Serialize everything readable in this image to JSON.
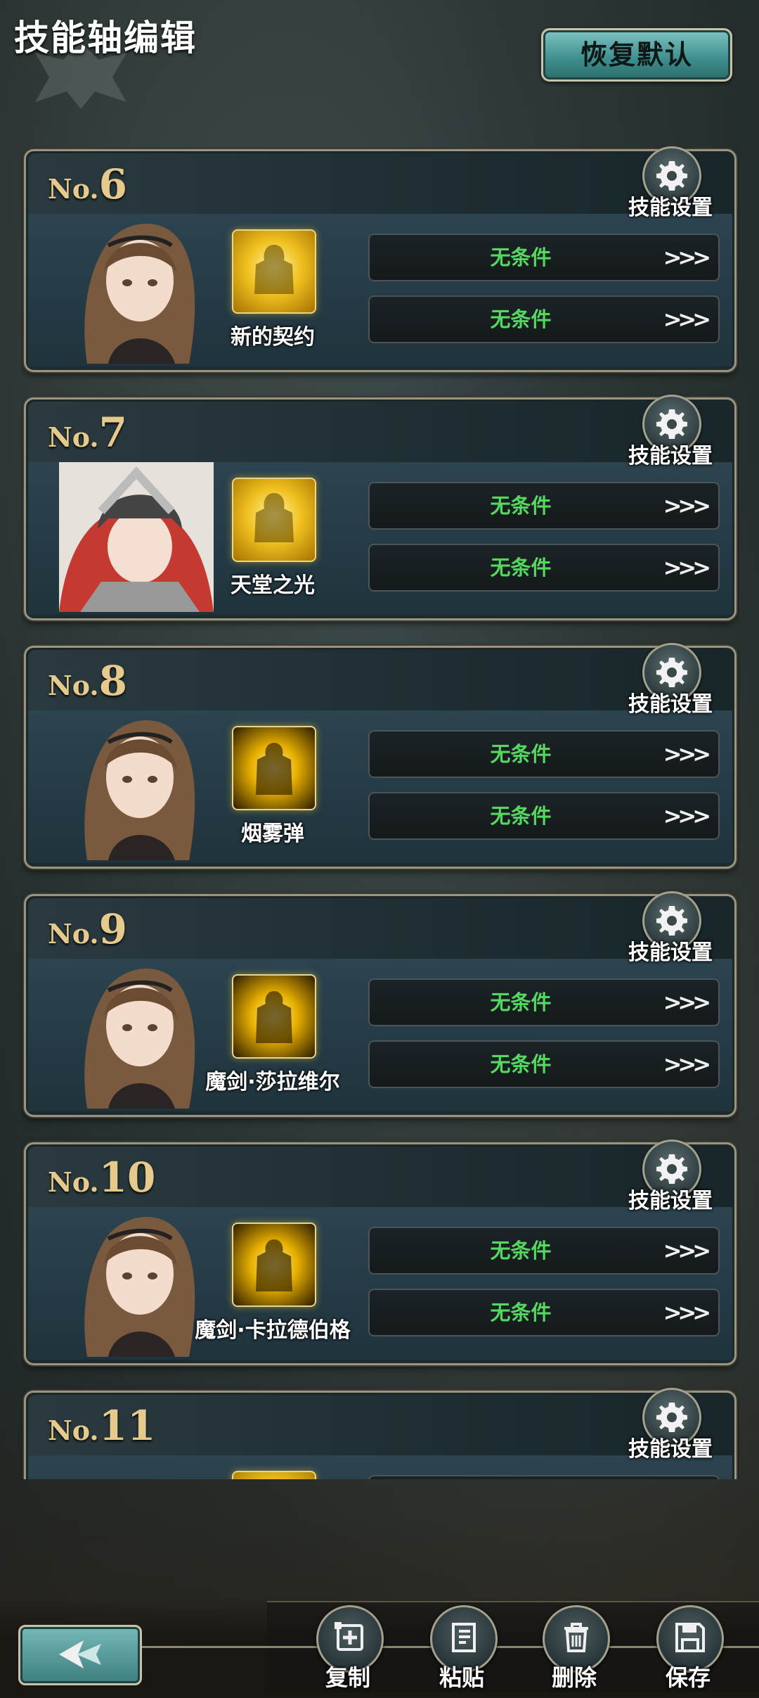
{
  "header": {
    "title": "技能轴编辑",
    "reset_label": "恢复默认"
  },
  "skill_settings_label": "技能设置",
  "condition_arrows": ">>>",
  "cards": [
    {
      "no_prefix": "No.",
      "number": "6",
      "skill_name": "新的契约",
      "conditions": [
        "无条件",
        "无条件"
      ]
    },
    {
      "no_prefix": "No.",
      "number": "7",
      "skill_name": "天堂之光",
      "conditions": [
        "无条件",
        "无条件"
      ]
    },
    {
      "no_prefix": "No.",
      "number": "8",
      "skill_name": "烟雾弹",
      "conditions": [
        "无条件",
        "无条件"
      ]
    },
    {
      "no_prefix": "No.",
      "number": "9",
      "skill_name": "魔剑·莎拉维尔",
      "conditions": [
        "无条件",
        "无条件"
      ]
    },
    {
      "no_prefix": "No.",
      "number": "10",
      "skill_name": "魔剑·卡拉德伯格",
      "conditions": [
        "无条件",
        "无条件"
      ]
    },
    {
      "no_prefix": "No.",
      "number": "11",
      "skill_name": "",
      "conditions": [
        "",
        ""
      ]
    }
  ],
  "toolbar": {
    "copy_label": "复制",
    "paste_label": "粘贴",
    "delete_label": "删除",
    "save_label": "保存"
  },
  "colors": {
    "condition_text": "#55d860",
    "number_gold": "#e6c98c",
    "accent_teal": "#3d8d8d"
  }
}
